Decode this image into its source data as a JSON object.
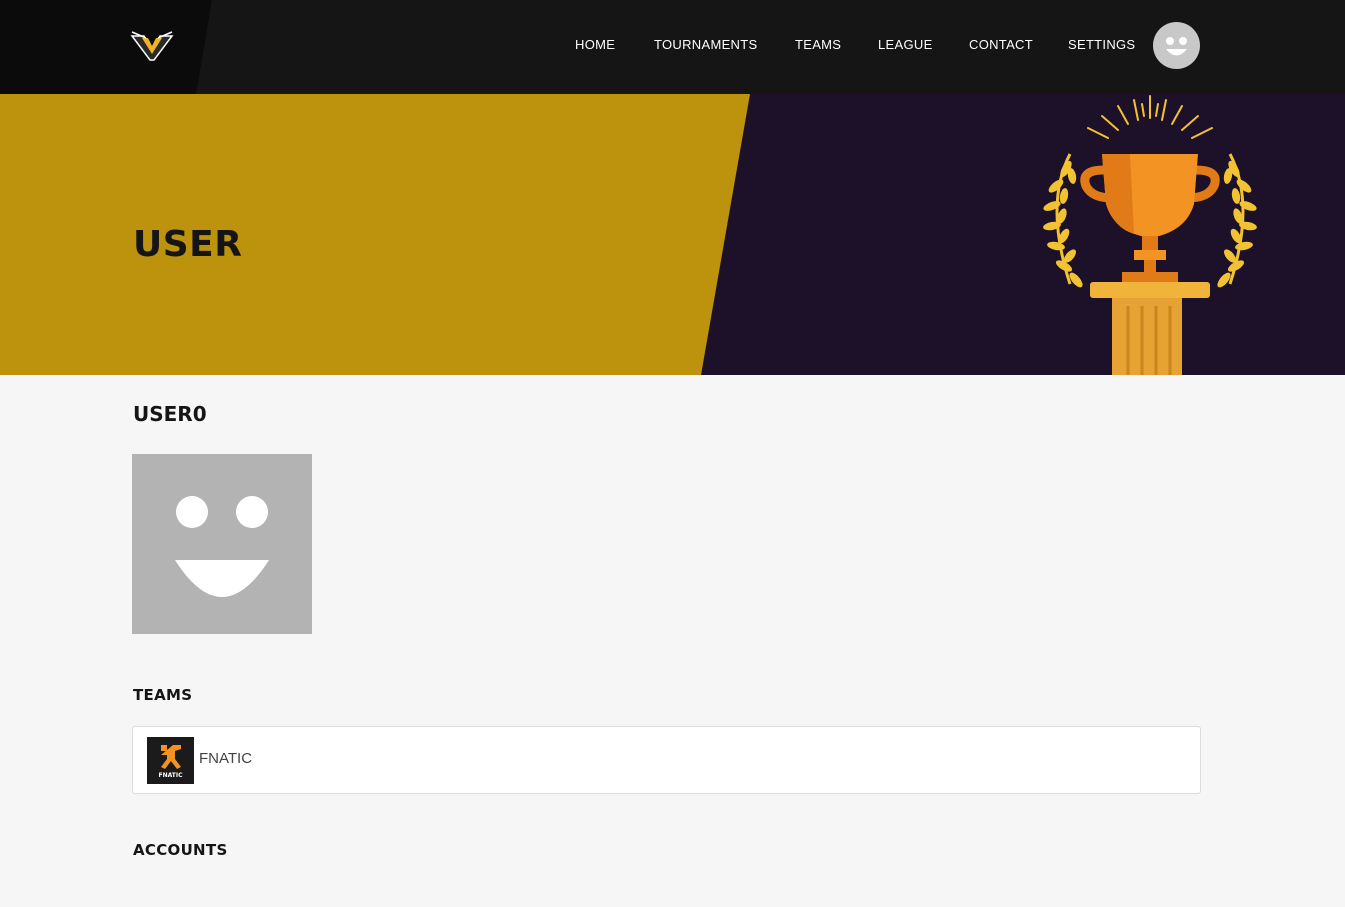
{
  "nav": {
    "items": [
      {
        "label": "HOME"
      },
      {
        "label": "TOURNAMENTS"
      },
      {
        "label": "TEAMS"
      },
      {
        "label": "LEAGUE"
      },
      {
        "label": "CONTACT"
      },
      {
        "label": "SETTINGS"
      }
    ]
  },
  "hero": {
    "title": "USER"
  },
  "profile": {
    "username": "USER0"
  },
  "teams": {
    "heading": "TEAMS",
    "items": [
      {
        "name": "FNATIC",
        "logo_text": "FNATIC"
      }
    ]
  },
  "accounts": {
    "heading": "ACCOUNTS"
  },
  "colors": {
    "navbar": "#151515",
    "hero_gold": "#bd920c",
    "hero_purple": "#1d1029",
    "trophy_orange": "#f39324",
    "laurel_yellow": "#f1c232",
    "avatar_grey": "#b3b3b3"
  }
}
